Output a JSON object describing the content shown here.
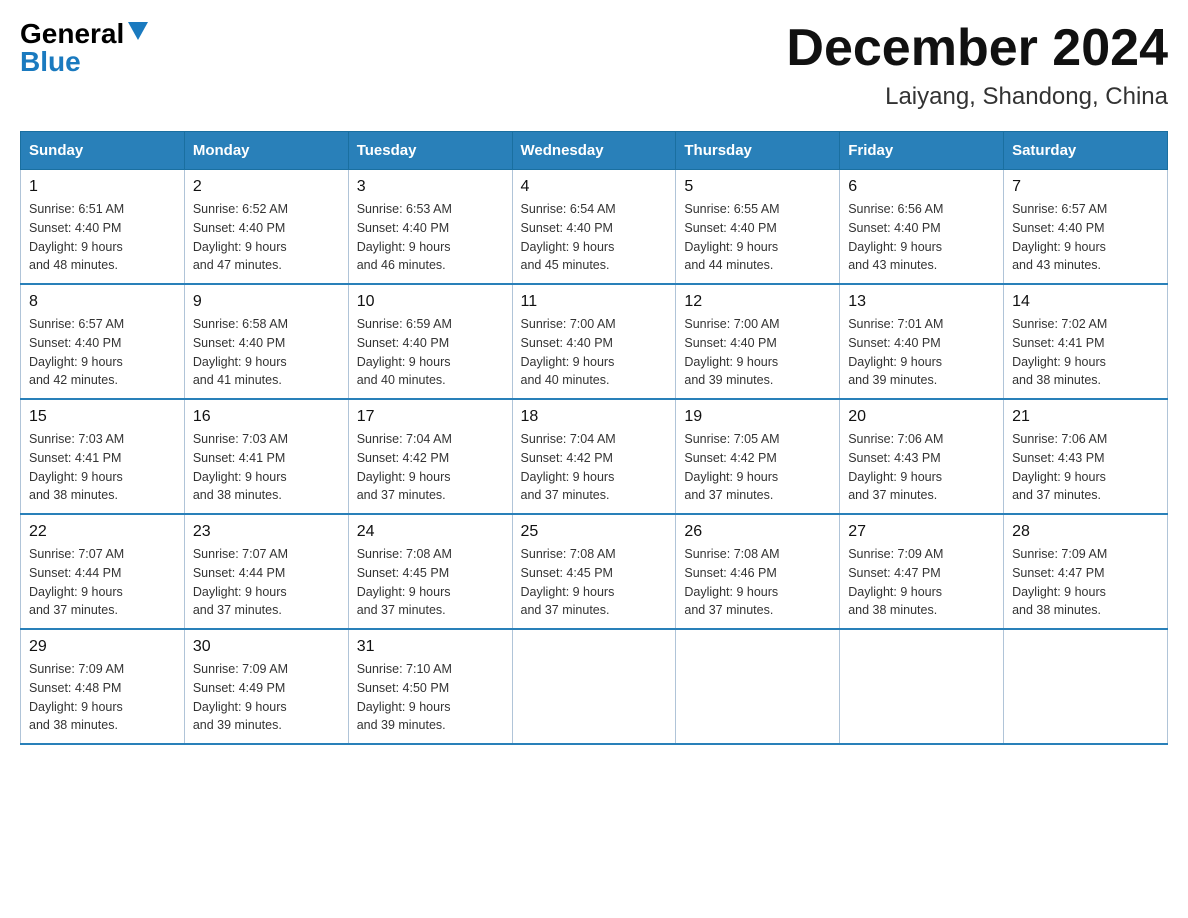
{
  "header": {
    "logo_general": "General",
    "logo_blue": "Blue",
    "title": "December 2024",
    "subtitle": "Laiyang, Shandong, China"
  },
  "days_of_week": [
    "Sunday",
    "Monday",
    "Tuesday",
    "Wednesday",
    "Thursday",
    "Friday",
    "Saturday"
  ],
  "weeks": [
    [
      {
        "day": "1",
        "sunrise": "6:51 AM",
        "sunset": "4:40 PM",
        "daylight": "9 hours and 48 minutes."
      },
      {
        "day": "2",
        "sunrise": "6:52 AM",
        "sunset": "4:40 PM",
        "daylight": "9 hours and 47 minutes."
      },
      {
        "day": "3",
        "sunrise": "6:53 AM",
        "sunset": "4:40 PM",
        "daylight": "9 hours and 46 minutes."
      },
      {
        "day": "4",
        "sunrise": "6:54 AM",
        "sunset": "4:40 PM",
        "daylight": "9 hours and 45 minutes."
      },
      {
        "day": "5",
        "sunrise": "6:55 AM",
        "sunset": "4:40 PM",
        "daylight": "9 hours and 44 minutes."
      },
      {
        "day": "6",
        "sunrise": "6:56 AM",
        "sunset": "4:40 PM",
        "daylight": "9 hours and 43 minutes."
      },
      {
        "day": "7",
        "sunrise": "6:57 AM",
        "sunset": "4:40 PM",
        "daylight": "9 hours and 43 minutes."
      }
    ],
    [
      {
        "day": "8",
        "sunrise": "6:57 AM",
        "sunset": "4:40 PM",
        "daylight": "9 hours and 42 minutes."
      },
      {
        "day": "9",
        "sunrise": "6:58 AM",
        "sunset": "4:40 PM",
        "daylight": "9 hours and 41 minutes."
      },
      {
        "day": "10",
        "sunrise": "6:59 AM",
        "sunset": "4:40 PM",
        "daylight": "9 hours and 40 minutes."
      },
      {
        "day": "11",
        "sunrise": "7:00 AM",
        "sunset": "4:40 PM",
        "daylight": "9 hours and 40 minutes."
      },
      {
        "day": "12",
        "sunrise": "7:00 AM",
        "sunset": "4:40 PM",
        "daylight": "9 hours and 39 minutes."
      },
      {
        "day": "13",
        "sunrise": "7:01 AM",
        "sunset": "4:40 PM",
        "daylight": "9 hours and 39 minutes."
      },
      {
        "day": "14",
        "sunrise": "7:02 AM",
        "sunset": "4:41 PM",
        "daylight": "9 hours and 38 minutes."
      }
    ],
    [
      {
        "day": "15",
        "sunrise": "7:03 AM",
        "sunset": "4:41 PM",
        "daylight": "9 hours and 38 minutes."
      },
      {
        "day": "16",
        "sunrise": "7:03 AM",
        "sunset": "4:41 PM",
        "daylight": "9 hours and 38 minutes."
      },
      {
        "day": "17",
        "sunrise": "7:04 AM",
        "sunset": "4:42 PM",
        "daylight": "9 hours and 37 minutes."
      },
      {
        "day": "18",
        "sunrise": "7:04 AM",
        "sunset": "4:42 PM",
        "daylight": "9 hours and 37 minutes."
      },
      {
        "day": "19",
        "sunrise": "7:05 AM",
        "sunset": "4:42 PM",
        "daylight": "9 hours and 37 minutes."
      },
      {
        "day": "20",
        "sunrise": "7:06 AM",
        "sunset": "4:43 PM",
        "daylight": "9 hours and 37 minutes."
      },
      {
        "day": "21",
        "sunrise": "7:06 AM",
        "sunset": "4:43 PM",
        "daylight": "9 hours and 37 minutes."
      }
    ],
    [
      {
        "day": "22",
        "sunrise": "7:07 AM",
        "sunset": "4:44 PM",
        "daylight": "9 hours and 37 minutes."
      },
      {
        "day": "23",
        "sunrise": "7:07 AM",
        "sunset": "4:44 PM",
        "daylight": "9 hours and 37 minutes."
      },
      {
        "day": "24",
        "sunrise": "7:08 AM",
        "sunset": "4:45 PM",
        "daylight": "9 hours and 37 minutes."
      },
      {
        "day": "25",
        "sunrise": "7:08 AM",
        "sunset": "4:45 PM",
        "daylight": "9 hours and 37 minutes."
      },
      {
        "day": "26",
        "sunrise": "7:08 AM",
        "sunset": "4:46 PM",
        "daylight": "9 hours and 37 minutes."
      },
      {
        "day": "27",
        "sunrise": "7:09 AM",
        "sunset": "4:47 PM",
        "daylight": "9 hours and 38 minutes."
      },
      {
        "day": "28",
        "sunrise": "7:09 AM",
        "sunset": "4:47 PM",
        "daylight": "9 hours and 38 minutes."
      }
    ],
    [
      {
        "day": "29",
        "sunrise": "7:09 AM",
        "sunset": "4:48 PM",
        "daylight": "9 hours and 38 minutes."
      },
      {
        "day": "30",
        "sunrise": "7:09 AM",
        "sunset": "4:49 PM",
        "daylight": "9 hours and 39 minutes."
      },
      {
        "day": "31",
        "sunrise": "7:10 AM",
        "sunset": "4:50 PM",
        "daylight": "9 hours and 39 minutes."
      },
      null,
      null,
      null,
      null
    ]
  ],
  "labels": {
    "sunrise": "Sunrise:",
    "sunset": "Sunset:",
    "daylight": "Daylight:"
  }
}
